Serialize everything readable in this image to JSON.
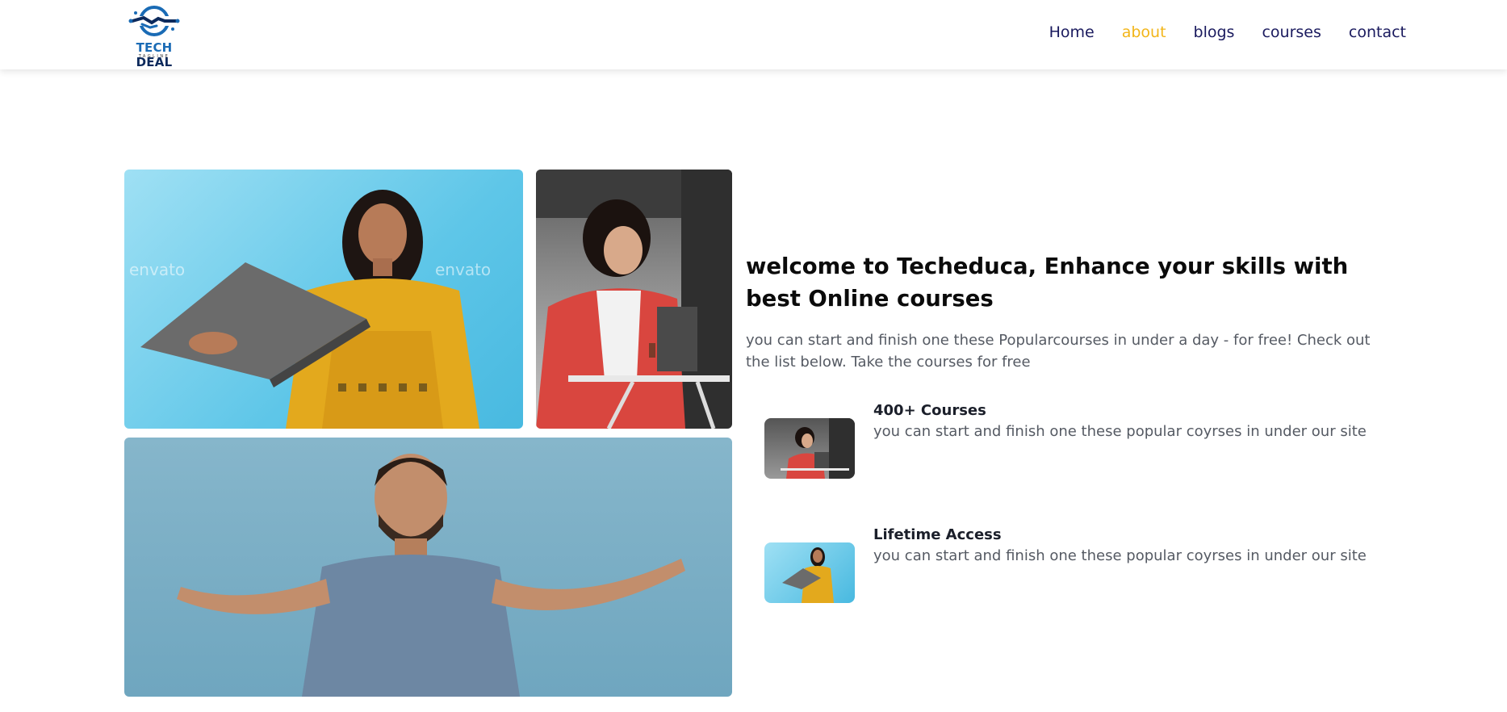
{
  "brand": {
    "name_part1": "TECH",
    "name_part2": "DEAL",
    "tagline": "TAGLINE"
  },
  "nav": {
    "items": [
      {
        "label": "Home",
        "active": false
      },
      {
        "label": "about",
        "active": true
      },
      {
        "label": "blogs",
        "active": false
      },
      {
        "label": "courses",
        "active": false
      },
      {
        "label": "contact",
        "active": false
      }
    ]
  },
  "colors": {
    "nav_text": "#1a1a5e",
    "nav_active": "#f2b519",
    "heading": "#0b0b0b",
    "body_text": "#555a63"
  },
  "photos": {
    "watermark": "envato"
  },
  "hero": {
    "headline": "welcome to Techeduca, Enhance your skills with best Online courses",
    "intro": "you can start and finish one these Popularcourses in under a day - for free! Check out the list below. Take the courses for free"
  },
  "features": [
    {
      "title": "400+ Courses",
      "description": "you can start and finish one these popular coyrses in under our site"
    },
    {
      "title": "Lifetime Access",
      "description": "you can start and finish one these popular coyrses in under our site"
    }
  ]
}
